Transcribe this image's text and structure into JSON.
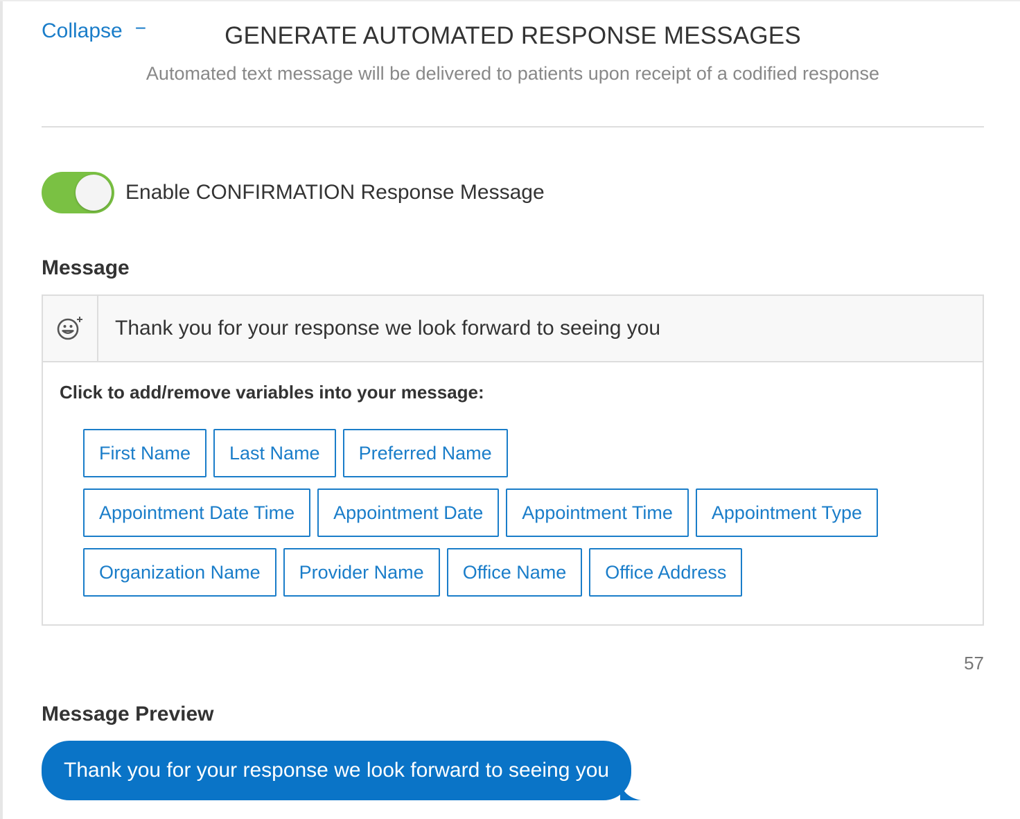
{
  "header": {
    "collapse_label": "Collapse",
    "collapse_icon": "minus-icon",
    "title": "GENERATE AUTOMATED RESPONSE MESSAGES",
    "subtitle": "Automated text message will be delivered to patients upon receipt of a codified response"
  },
  "toggle": {
    "enabled": true,
    "label": "Enable CONFIRMATION Response Message",
    "on_color": "#7ac143"
  },
  "message": {
    "heading": "Message",
    "emoji_icon": "add-emoji-icon",
    "value": "Thank you for your response we look forward to seeing you",
    "variables_title": "Click to add/remove variables into your message:",
    "variables": [
      [
        "First Name",
        "Last Name",
        "Preferred Name"
      ],
      [
        "Appointment Date Time",
        "Appointment Date",
        "Appointment Time",
        "Appointment Type"
      ],
      [
        "Organization Name",
        "Provider Name",
        "Office Name",
        "Office Address"
      ]
    ],
    "char_count": "57"
  },
  "preview": {
    "heading": "Message Preview",
    "text": "Thank you for your response we look forward to seeing you",
    "bubble_color": "#0a74c7"
  },
  "colors": {
    "accent": "#1a7dc9"
  }
}
